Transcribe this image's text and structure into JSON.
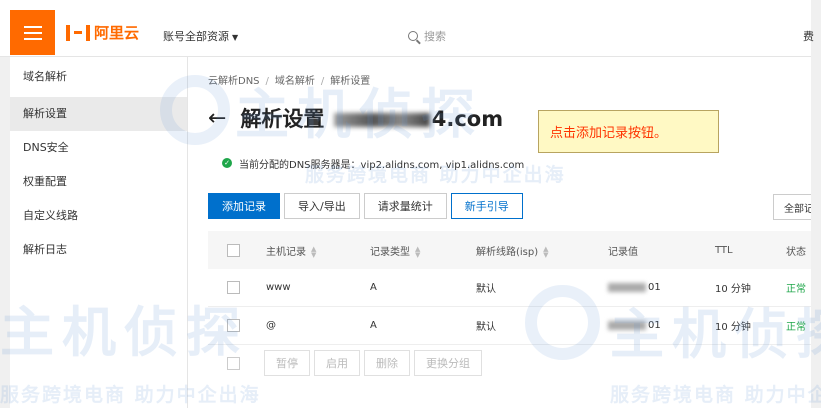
{
  "header": {
    "logo_text": "阿里云",
    "account_label": "账号全部资源",
    "search_placeholder": "搜索",
    "right_clip": "费"
  },
  "sidebar": {
    "title": "域名解析",
    "items": [
      {
        "label": "解析设置",
        "active": true
      },
      {
        "label": "DNS安全",
        "active": false
      },
      {
        "label": "权重配置",
        "active": false
      },
      {
        "label": "自定义线路",
        "active": false
      },
      {
        "label": "解析日志",
        "active": false
      }
    ]
  },
  "breadcrumb": [
    "云解析DNS",
    "域名解析",
    "解析设置"
  ],
  "page": {
    "title_prefix": "解析设置",
    "title_suffix": "4.com",
    "dns_info": "当前分配的DNS服务器是：vip2.alidns.com, vip1.alidns.com"
  },
  "callout": "点击添加记录按钮。",
  "toolbar": {
    "add_record": "添加记录",
    "import_export": "导入/导出",
    "request_stats": "请求量统计",
    "guide": "新手引导",
    "right_clip": "全部记"
  },
  "table": {
    "headers": [
      "主机记录",
      "记录类型",
      "解析线路(isp)",
      "记录值",
      "TTL",
      "状态"
    ],
    "rows": [
      {
        "host": "www",
        "type": "A",
        "line": "默认",
        "value_tail": "01",
        "ttl": "10 分钟",
        "status": "正常"
      },
      {
        "host": "@",
        "type": "A",
        "line": "默认",
        "value_tail": "01",
        "ttl": "10 分钟",
        "status": "正常"
      }
    ]
  },
  "bulk": {
    "pause": "暂停",
    "enable": "启用",
    "delete": "删除",
    "change_group": "更换分组"
  },
  "watermark": {
    "brand": "主机侦探",
    "slogan": "服务跨境电商 助力中企出海"
  },
  "colors": {
    "brand_orange": "#ff6a00",
    "primary_blue": "#0070cc",
    "status_green": "#1fa64a",
    "callout_text": "#ff3300"
  }
}
